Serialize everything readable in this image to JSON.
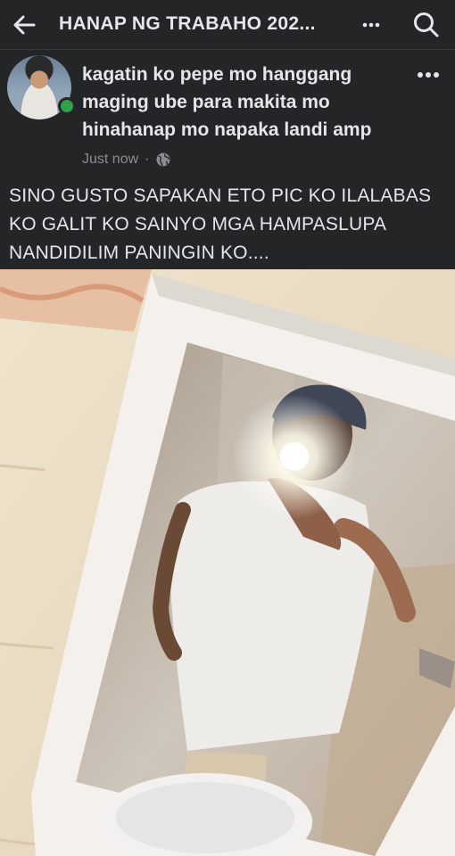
{
  "header": {
    "group_title": "HANAP NG TRABAHO 202...",
    "back_icon": "arrow-left-icon",
    "more_icon": "more-horizontal-icon",
    "search_icon": "search-icon"
  },
  "post": {
    "author_name": "kagatin ko pepe mo hanggang maging ube para makita mo hinahanap mo napaka landi amp",
    "timestamp": "Just now",
    "separator": "·",
    "audience_icon": "globe-icon",
    "body_text": "SINO GUSTO SAPAKAN ETO PIC KO ILALABAS KO GALIT KO SAINYO MGA HAMPASLUPA NANDIDILIM PANINGIN KO....",
    "online": true
  },
  "colors": {
    "background": "#242526",
    "text": "#e4e6eb",
    "secondary_text": "#8a8d91",
    "online_green": "#31a24c"
  }
}
